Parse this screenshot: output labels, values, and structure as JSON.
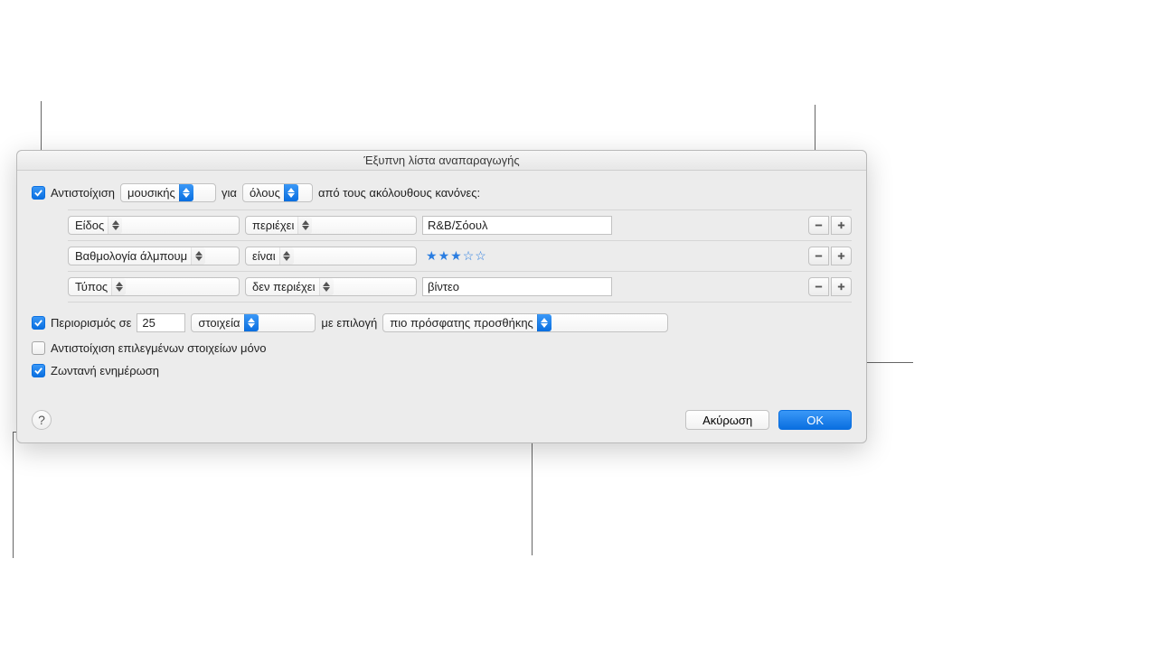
{
  "dialog": {
    "title": "Έξυπνη λίστα αναπαραγωγής"
  },
  "match": {
    "checked": true,
    "label_pre": "Αντιστοίχιση",
    "media": "μουσικής",
    "label_mid": "για",
    "scope": "όλους",
    "label_post": "από τους ακόλουθους κανόνες:"
  },
  "rules": [
    {
      "field": "Είδος",
      "operator": "περιέχει",
      "value_type": "text",
      "value": "R&B/Σόουλ"
    },
    {
      "field": "Βαθμολογία άλμπουμ",
      "operator": "είναι",
      "value_type": "stars",
      "stars": 3,
      "max_stars": 5
    },
    {
      "field": "Τύπος",
      "operator": "δεν περιέχει",
      "value_type": "text",
      "value": "βίντεο"
    }
  ],
  "limit": {
    "checked": true,
    "label_pre": "Περιορισμός σε",
    "value": "25",
    "unit": "στοιχεία",
    "label_mid": "με επιλογή",
    "selection": "πιο πρόσφατης προσθήκης"
  },
  "match_selected_only": {
    "checked": false,
    "label": "Αντιστοίχιση επιλεγμένων στοιχείων μόνο"
  },
  "live_update": {
    "checked": true,
    "label": "Ζωντανή ενημέρωση"
  },
  "footer": {
    "cancel": "Ακύρωση",
    "ok": "OK"
  }
}
